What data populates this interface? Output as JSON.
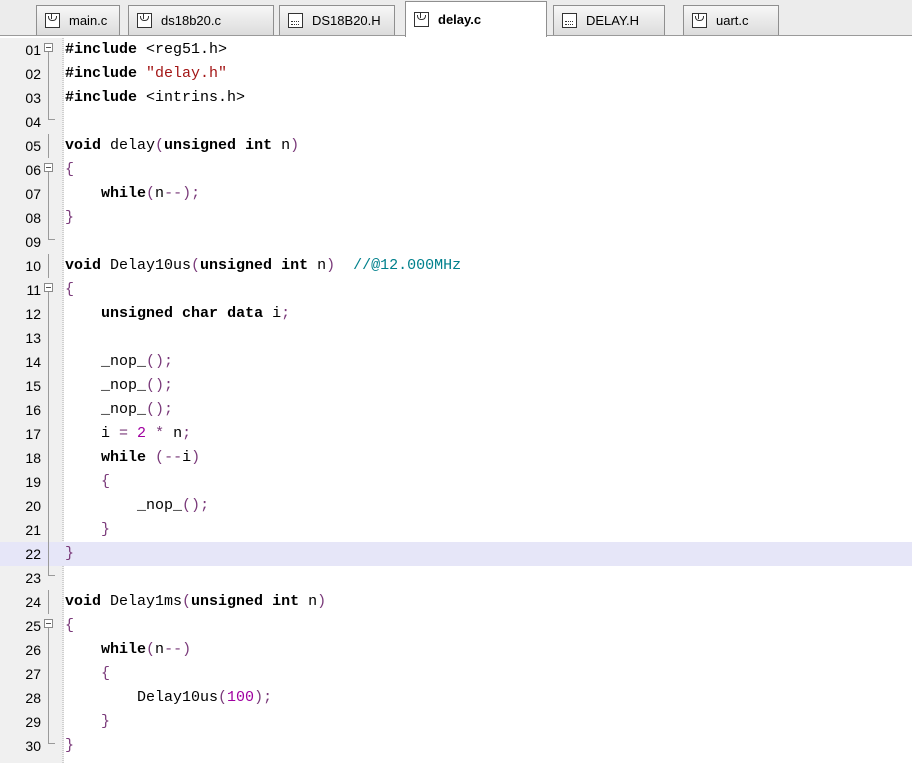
{
  "tabs": [
    {
      "label": "main.c",
      "icon": "c-file-icon",
      "active": false
    },
    {
      "label": "ds18b20.c",
      "icon": "c-file-icon",
      "active": false
    },
    {
      "label": "DS18B20.H",
      "icon": "h-file-icon",
      "active": false
    },
    {
      "label": "delay.c",
      "icon": "c-file-icon",
      "active": true
    },
    {
      "label": "DELAY.H",
      "icon": "h-file-icon",
      "active": false
    },
    {
      "label": "uart.c",
      "icon": "c-file-icon",
      "active": false
    }
  ],
  "editor": {
    "highlighted_line": "22",
    "lines": [
      {
        "n": "01",
        "text": "#include <reg51.h>"
      },
      {
        "n": "02",
        "text": "#include \"delay.h\""
      },
      {
        "n": "03",
        "text": "#include <intrins.h>"
      },
      {
        "n": "04",
        "text": ""
      },
      {
        "n": "05",
        "text": "void delay(unsigned int n)"
      },
      {
        "n": "06",
        "text": "{"
      },
      {
        "n": "07",
        "text": "    while(n--);"
      },
      {
        "n": "08",
        "text": "}"
      },
      {
        "n": "09",
        "text": ""
      },
      {
        "n": "10",
        "text": "void Delay10us(unsigned int n)  //@12.000MHz"
      },
      {
        "n": "11",
        "text": "{"
      },
      {
        "n": "12",
        "text": "    unsigned char data i;"
      },
      {
        "n": "13",
        "text": ""
      },
      {
        "n": "14",
        "text": "    _nop_();"
      },
      {
        "n": "15",
        "text": "    _nop_();"
      },
      {
        "n": "16",
        "text": "    _nop_();"
      },
      {
        "n": "17",
        "text": "    i = 2 * n;"
      },
      {
        "n": "18",
        "text": "    while (--i)"
      },
      {
        "n": "19",
        "text": "    {"
      },
      {
        "n": "20",
        "text": "        _nop_();"
      },
      {
        "n": "21",
        "text": "    }"
      },
      {
        "n": "22",
        "text": "}"
      },
      {
        "n": "23",
        "text": ""
      },
      {
        "n": "24",
        "text": "void Delay1ms(unsigned int n)"
      },
      {
        "n": "25",
        "text": "{"
      },
      {
        "n": "26",
        "text": "    while(n--)"
      },
      {
        "n": "27",
        "text": "    {"
      },
      {
        "n": "28",
        "text": "        Delay10us(100);"
      },
      {
        "n": "29",
        "text": "    }"
      },
      {
        "n": "30",
        "text": "}"
      }
    ]
  }
}
